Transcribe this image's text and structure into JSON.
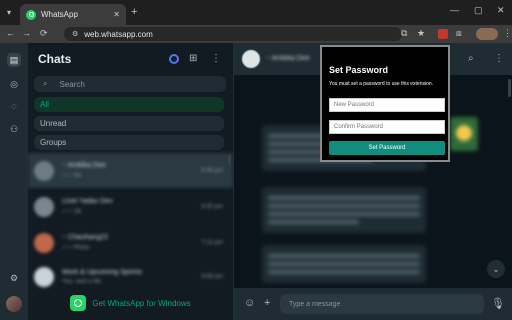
{
  "browser": {
    "tab_title": "WhatsApp",
    "tab_close": "✕",
    "new_tab": "+",
    "window_controls": [
      "—",
      "▢",
      "✕"
    ],
    "url": "web.whatsapp.com",
    "nav": [
      "←",
      "→",
      "⟳"
    ]
  },
  "sidebar_rail": {
    "icons": [
      "chats-icon",
      "status-icon",
      "channels-icon",
      "communities-icon",
      "settings-icon"
    ]
  },
  "chatlist": {
    "title": "Chats",
    "search_placeholder": "Search",
    "filters": [
      "All",
      "Unread",
      "Groups"
    ],
    "items": [
      {
        "name": "~ Ambika Dee",
        "sub": "✓✓ No",
        "time": "8:45 pm"
      },
      {
        "name": "Linet Yadav Dev",
        "sub": "✓✓ Ok",
        "time": "8:30 pm"
      },
      {
        "name": "~ Chauhang22",
        "sub": "✓✓ Photo",
        "time": "7:12 pm"
      },
      {
        "name": "Work & Upcoming Sprints",
        "sub": "You: sent a file",
        "time": "6:58 pm"
      }
    ],
    "get_app_label": "Get WhatsApp for Windows"
  },
  "conversation": {
    "contact_name": "~ Ambika Dee",
    "composer_placeholder": "Type a message"
  },
  "extension_popup": {
    "title": "Set Password",
    "description": "You must set a password to use this extension.",
    "new_password_placeholder": "New Password",
    "confirm_password_placeholder": "Confirm Password",
    "button_label": "Set Password"
  },
  "colors": {
    "accent": "#00a884",
    "popup_button": "#128c7e",
    "app_bg": "#111b21"
  }
}
